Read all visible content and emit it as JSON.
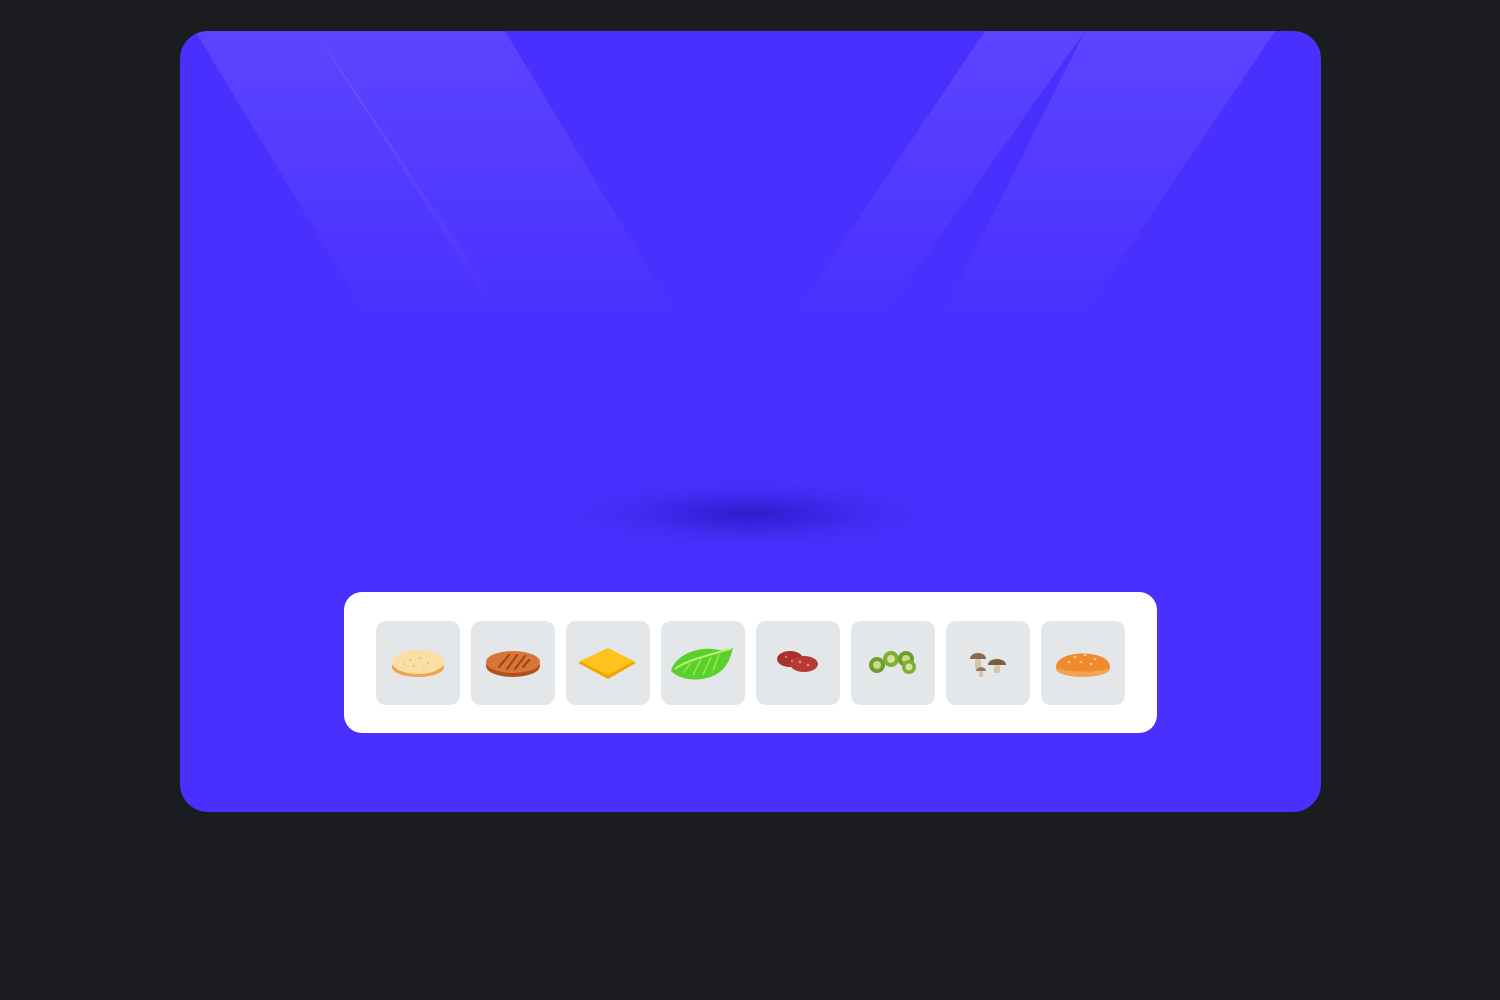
{
  "app": {
    "type": "burger-builder",
    "colors": {
      "background": "#1b1c1f",
      "stage": "#4a30ff",
      "tray": "#ffffff",
      "slot": "#e3e7ea"
    }
  },
  "ingredients": [
    {
      "name": "bottom-bun",
      "icon": "bottom-bun-icon"
    },
    {
      "name": "patty",
      "icon": "patty-icon"
    },
    {
      "name": "cheese",
      "icon": "cheese-icon"
    },
    {
      "name": "lettuce",
      "icon": "lettuce-icon"
    },
    {
      "name": "salami",
      "icon": "salami-icon"
    },
    {
      "name": "green-peppers",
      "icon": "green-pepper-icon"
    },
    {
      "name": "mushrooms",
      "icon": "mushroom-icon"
    },
    {
      "name": "top-bun",
      "icon": "top-bun-icon"
    }
  ]
}
